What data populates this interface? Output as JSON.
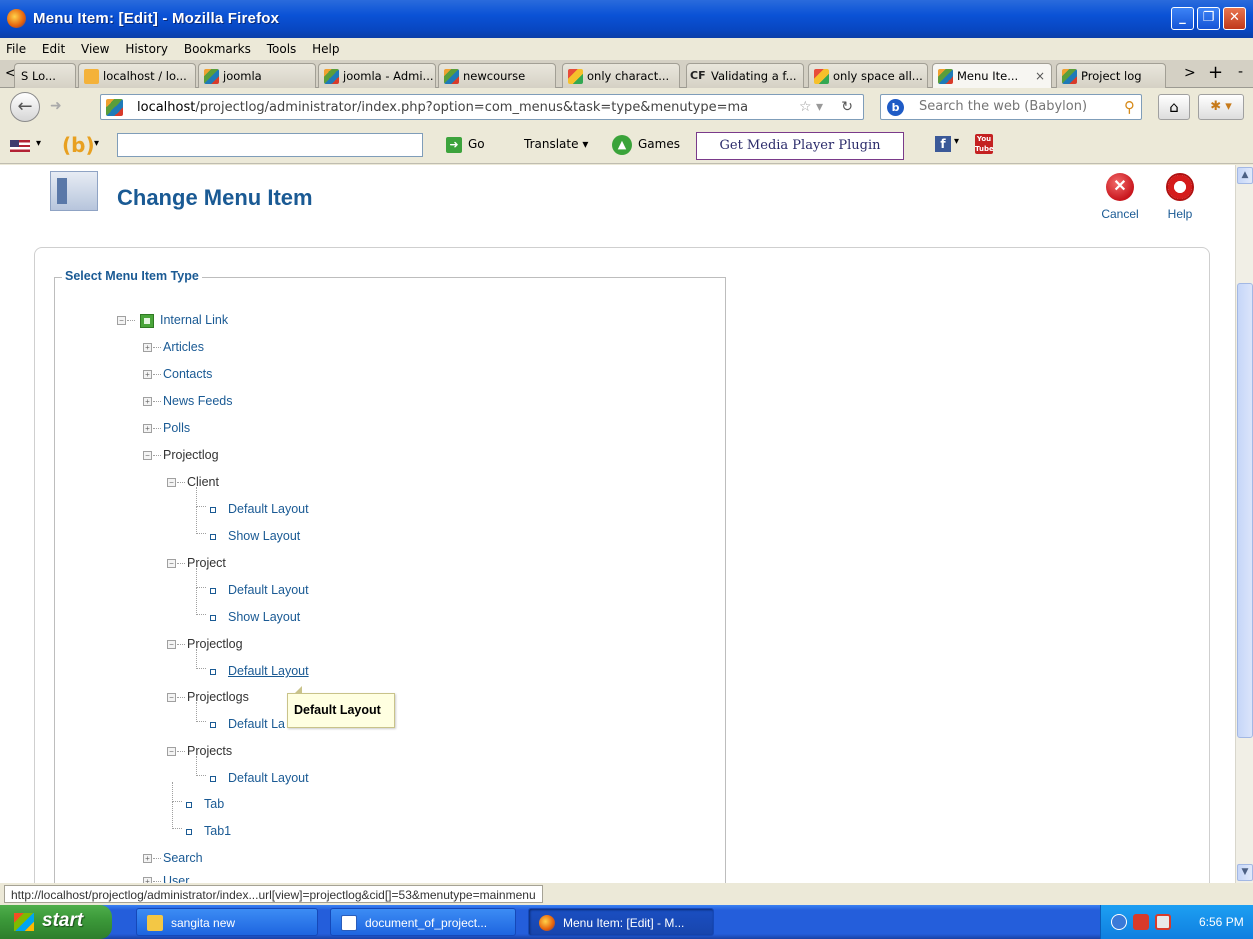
{
  "window": {
    "title": "Menu Item: [Edit] - Mozilla Firefox",
    "controls": [
      "_",
      "❐",
      "✕"
    ]
  },
  "menubar": [
    "File",
    "Edit",
    "View",
    "History",
    "Bookmarks",
    "Tools",
    "Help"
  ],
  "tabs": [
    {
      "label": "S Lo...",
      "icon": "arrow-left-icon"
    },
    {
      "label": "localhost / lo...",
      "icon": "phpmyadmin-icon"
    },
    {
      "label": "joomla",
      "icon": "joomla-icon"
    },
    {
      "label": "joomla - Admi...",
      "icon": "joomla-icon"
    },
    {
      "label": "newcourse",
      "icon": "joomla-icon"
    },
    {
      "label": "only charact...",
      "icon": "google-icon"
    },
    {
      "label": "Validating a f...",
      "icon": "cf-icon"
    },
    {
      "label": "only space all...",
      "icon": "google-icon"
    },
    {
      "label": "Menu Ite...",
      "icon": "joomla-icon",
      "active": true,
      "close": "×"
    },
    {
      "label": "Project log",
      "icon": "joomla-icon"
    }
  ],
  "tab_controls": {
    "scroll_right": ">",
    "new_tab": "+",
    "list": "-",
    "scroll_left": "<"
  },
  "navbar": {
    "url_host": "localhost",
    "url_path": "/projectlog/administrator/index.php?option=com_menus&task=type&menutype=ma",
    "search_placeholder": "Search the web (Babylon)"
  },
  "babylon": {
    "go_label": "Go",
    "translate_label": "Translate",
    "games_label": "Games",
    "media_label": "Get Media Player Plugin",
    "youtube_label": "You Tube"
  },
  "page": {
    "title": "Change Menu Item",
    "cancel_label": "Cancel",
    "help_label": "Help",
    "legend": "Select Menu Item Type",
    "tooltip": "Default Layout"
  },
  "tree": {
    "internal_link": "Internal Link",
    "articles": "Articles",
    "contacts": "Contacts",
    "news_feeds": "News Feeds",
    "polls": "Polls",
    "projectlog": "Projectlog",
    "client": "Client",
    "client_default": "Default Layout",
    "client_show": "Show Layout",
    "project": "Project",
    "project_default": "Default Layout",
    "project_show": "Show Layout",
    "projectlog_view": "Projectlog",
    "projectlog_default": "Default Layout",
    "projectlogs": "Projectlogs",
    "projectlogs_default": "Default La",
    "projects": "Projects",
    "projects_default": "Default Layout",
    "tab": "Tab",
    "tab1": "Tab1",
    "search": "Search",
    "user": "User"
  },
  "statusbar": {
    "text": "http://localhost/projectlog/administrator/index...url[view]=projectlog&cid[]=53&menutype=mainmenu"
  },
  "taskbar": {
    "start_label": "start",
    "tasks": [
      "sangita new",
      "document_of_project...",
      "Menu Item: [Edit] - M..."
    ],
    "clock": "6:56 PM"
  }
}
